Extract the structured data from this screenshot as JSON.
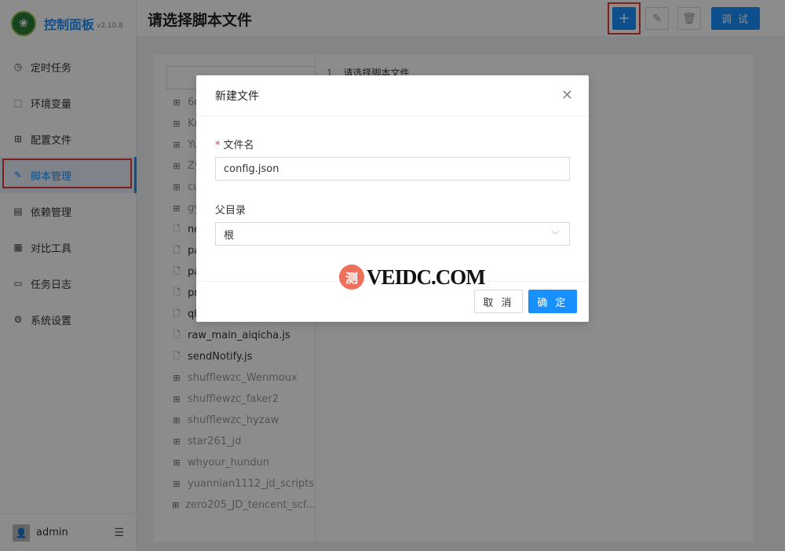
{
  "app": {
    "title": "控制面板",
    "version": "v2.10.8"
  },
  "sidebar": {
    "items": [
      {
        "label": "定时任务",
        "icon": "clock-icon",
        "glyph": "◷"
      },
      {
        "label": "环境变量",
        "icon": "scan-icon",
        "glyph": "⬚"
      },
      {
        "label": "配置文件",
        "icon": "control-icon",
        "glyph": "⊞"
      },
      {
        "label": "脚本管理",
        "icon": "form-edit-icon",
        "glyph": "✎"
      },
      {
        "label": "依赖管理",
        "icon": "container-icon",
        "glyph": "▤"
      },
      {
        "label": "对比工具",
        "icon": "diff-icon",
        "glyph": "▦"
      },
      {
        "label": "任务日志",
        "icon": "folder-icon",
        "glyph": "▭"
      },
      {
        "label": "系统设置",
        "icon": "setting-icon",
        "glyph": "⚙"
      }
    ],
    "active_index": 3,
    "user": "admin"
  },
  "header": {
    "title": "请选择脚本文件",
    "debug_label": "调 试"
  },
  "editor": {
    "line_number": "1",
    "line_text": "请选择脚本文件"
  },
  "tree": {
    "items": [
      {
        "label": "6d",
        "type": "folder"
      },
      {
        "label": "Kr",
        "type": "folder"
      },
      {
        "label": "Yu",
        "type": "folder"
      },
      {
        "label": "Zy",
        "type": "folder"
      },
      {
        "label": "cu",
        "type": "folder"
      },
      {
        "label": "gy",
        "type": "folder"
      },
      {
        "label": "no",
        "type": "file"
      },
      {
        "label": "pa",
        "type": "file"
      },
      {
        "label": "pa_",
        "type": "file"
      },
      {
        "label": "pr",
        "type": "file"
      },
      {
        "label": "ql",
        "type": "file"
      },
      {
        "label": "raw_main_aiqicha.js",
        "type": "file"
      },
      {
        "label": "sendNotify.js",
        "type": "file"
      },
      {
        "label": "shufflewzc_Wenmoux",
        "type": "folder"
      },
      {
        "label": "shufflewzc_faker2",
        "type": "folder"
      },
      {
        "label": "shufflewzc_hyzaw",
        "type": "folder"
      },
      {
        "label": "star261_jd",
        "type": "folder"
      },
      {
        "label": "whyour_hundun",
        "type": "folder"
      },
      {
        "label": "yuannian1112_jd_scripts",
        "type": "folder"
      },
      {
        "label": "zero205_JD_tencent_scf...",
        "type": "folder"
      }
    ]
  },
  "modal": {
    "title": "新建文件",
    "filename_label": "文件名",
    "filename_value": "config.json",
    "parent_label": "父目录",
    "parent_value": "根",
    "cancel_label": "取 消",
    "ok_label": "确 定"
  },
  "watermark": {
    "badge": "测",
    "text": "VEIDC.COM"
  },
  "colors": {
    "primary": "#1890ff",
    "highlight": "#e53935",
    "watermark": "#f06f5b"
  }
}
